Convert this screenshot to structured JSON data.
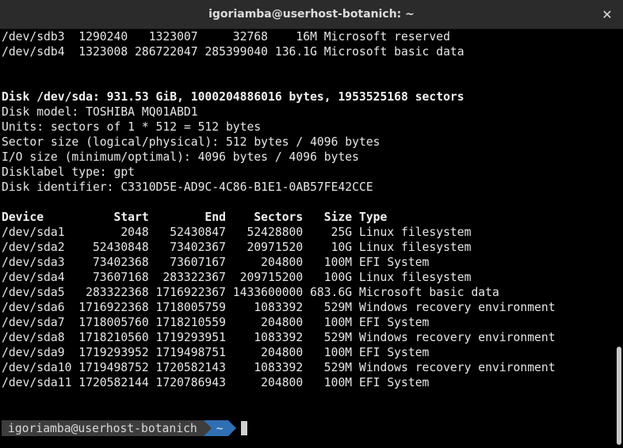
{
  "window": {
    "title": "igoriamba@userhost-botanich: ~",
    "close_glyph": "✕"
  },
  "terminal": {
    "lines": [
      {
        "text": "/dev/sdb3  1290240   1323007     32768    16M Microsoft reserved",
        "bold": false
      },
      {
        "text": "/dev/sdb4  1323008 286722047 285399040 136.1G Microsoft basic data",
        "bold": false
      },
      {
        "text": "",
        "bold": false
      },
      {
        "text": "",
        "bold": false
      },
      {
        "text": "Disk /dev/sda: 931.53 GiB, 1000204886016 bytes, 1953525168 sectors",
        "bold": true
      },
      {
        "text": "Disk model: TOSHIBA MQ01ABD1",
        "bold": false
      },
      {
        "text": "Units: sectors of 1 * 512 = 512 bytes",
        "bold": false
      },
      {
        "text": "Sector size (logical/physical): 512 bytes / 4096 bytes",
        "bold": false
      },
      {
        "text": "I/O size (minimum/optimal): 4096 bytes / 4096 bytes",
        "bold": false
      },
      {
        "text": "Disklabel type: gpt",
        "bold": false
      },
      {
        "text": "Disk identifier: C3310D5E-AD9C-4C86-B1E1-0AB57FE42CCE",
        "bold": false
      },
      {
        "text": "",
        "bold": false
      },
      {
        "text": "Device          Start        End    Sectors   Size Type",
        "bold": true
      },
      {
        "text": "/dev/sda1        2048   52430847   52428800    25G Linux filesystem",
        "bold": false
      },
      {
        "text": "/dev/sda2    52430848   73402367   20971520    10G Linux filesystem",
        "bold": false
      },
      {
        "text": "/dev/sda3    73402368   73607167     204800   100M EFI System",
        "bold": false
      },
      {
        "text": "/dev/sda4    73607168  283322367  209715200   100G Linux filesystem",
        "bold": false
      },
      {
        "text": "/dev/sda5   283322368 1716922367 1433600000 683.6G Microsoft basic data",
        "bold": false
      },
      {
        "text": "/dev/sda6  1716922368 1718005759    1083392   529M Windows recovery environment",
        "bold": false
      },
      {
        "text": "/dev/sda7  1718005760 1718210559     204800   100M EFI System",
        "bold": false
      },
      {
        "text": "/dev/sda8  1718210560 1719293951    1083392   529M Windows recovery environment",
        "bold": false
      },
      {
        "text": "/dev/sda9  1719293952 1719498751     204800   100M EFI System",
        "bold": false
      },
      {
        "text": "/dev/sda10 1719498752 1720582143    1083392   529M Windows recovery environment",
        "bold": false
      },
      {
        "text": "/dev/sda11 1720582144 1720786943     204800   100M EFI System",
        "bold": false
      }
    ]
  },
  "prompt": {
    "user_host": "igoriamba@userhost-botanich",
    "directory": "~"
  },
  "colors": {
    "background": "#000000",
    "prompt_user_bg": "#3d3d3d",
    "prompt_dir_bg": "#2f6fb4"
  }
}
